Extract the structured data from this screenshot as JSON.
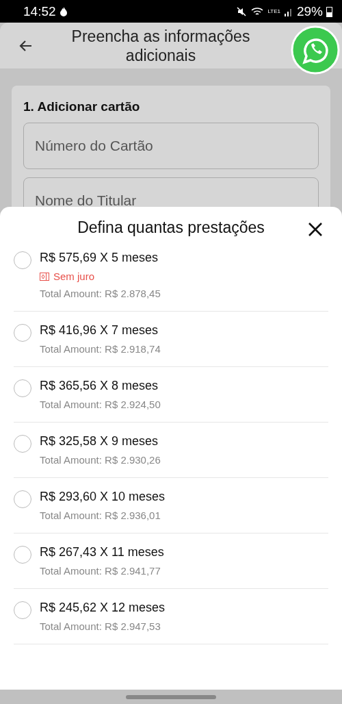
{
  "status_bar": {
    "time": "14:52",
    "battery": "29%",
    "network": "LTE1"
  },
  "header": {
    "title": "Preencha as informações adicionais"
  },
  "card": {
    "title": "1. Adicionar cartão",
    "fields": [
      {
        "placeholder": "Número do Cartão"
      },
      {
        "placeholder": "Nome do Titular"
      }
    ]
  },
  "sheet": {
    "title": "Defina quantas prestações",
    "options": [
      {
        "label": "R$ 575,69 X 5 meses",
        "tag": "Sem juro",
        "total": "Total Amount: R$ 2.878,45",
        "selected": false
      },
      {
        "label": "R$ 416,96 X 7 meses",
        "total": "Total Amount: R$ 2.918,74",
        "selected": false
      },
      {
        "label": "R$ 365,56 X 8 meses",
        "total": "Total Amount: R$ 2.924,50",
        "selected": false
      },
      {
        "label": "R$ 325,58 X 9 meses",
        "total": "Total Amount: R$ 2.930,26",
        "selected": false
      },
      {
        "label": "R$ 293,60 X 10 meses",
        "total": "Total Amount: R$ 2.936,01",
        "selected": false
      },
      {
        "label": "R$ 267,43 X 11 meses",
        "total": "Total Amount: R$ 2.941,77",
        "selected": false
      },
      {
        "label": "R$ 245,62 X 12 meses",
        "total": "Total Amount: R$ 2.947,53",
        "selected": false
      }
    ]
  }
}
